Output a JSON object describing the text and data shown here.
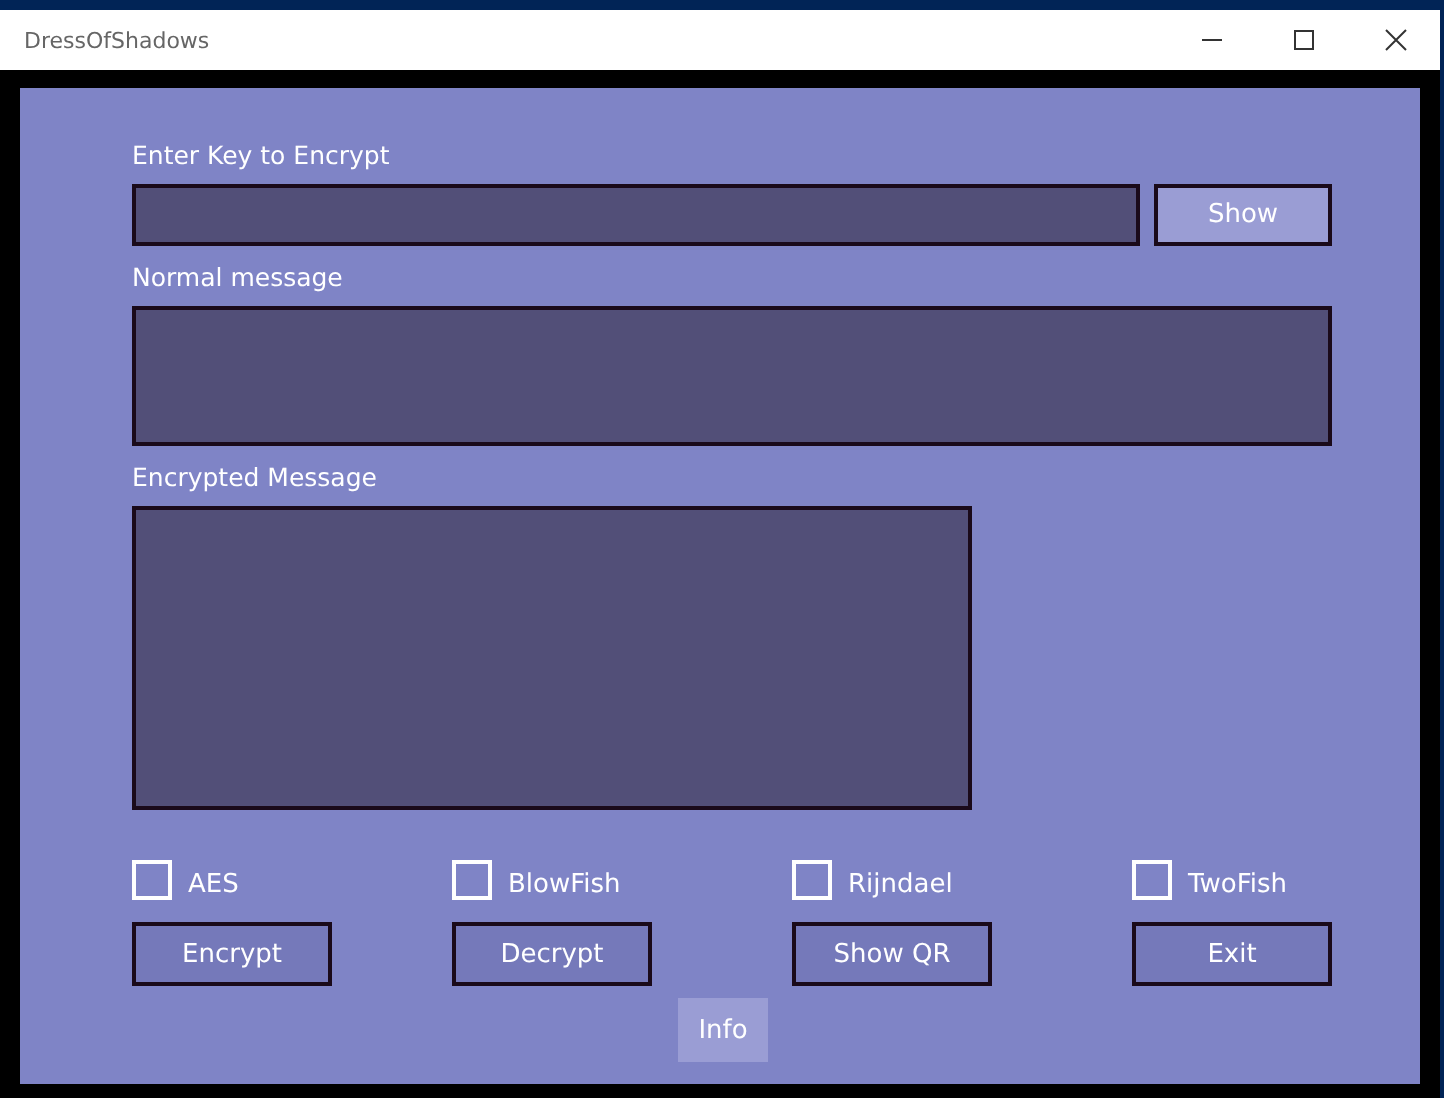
{
  "window": {
    "title": "DressOfShadows"
  },
  "key": {
    "label": "Enter Key to Encrypt",
    "button": "Show"
  },
  "normal_message": {
    "label": "Normal message"
  },
  "encrypted_message": {
    "label": "Encrypted Message"
  },
  "algorithms": [
    {
      "label": "AES",
      "checked": false
    },
    {
      "label": "BlowFish",
      "checked": false
    },
    {
      "label": "Rijndael",
      "checked": false
    },
    {
      "label": "TwoFish",
      "checked": false
    }
  ],
  "buttons": [
    "Encrypt",
    "Decrypt",
    "Show QR",
    "Exit"
  ],
  "info_button": "Info"
}
